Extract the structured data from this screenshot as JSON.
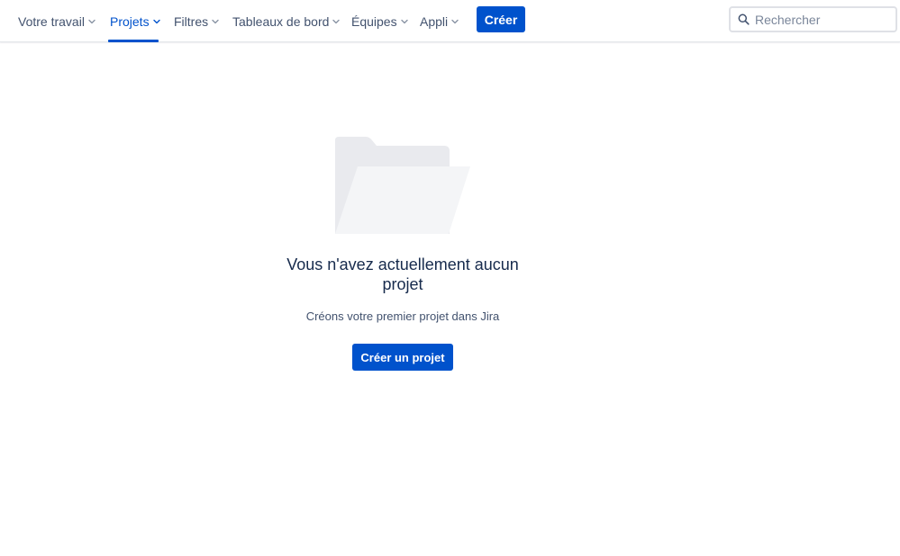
{
  "nav": {
    "items": [
      {
        "label": "Votre travail",
        "active": false
      },
      {
        "label": "Projets",
        "active": true
      },
      {
        "label": "Filtres",
        "active": false
      },
      {
        "label": "Tableaux de bord",
        "active": false
      },
      {
        "label": "Équipes",
        "active": false
      },
      {
        "label": "Appli",
        "active": false
      }
    ],
    "create_label": "Créer",
    "search_placeholder": "Rechercher",
    "search_icon": "search-icon",
    "dropdown_icon": "chevron-down-icon"
  },
  "empty_state": {
    "illustration": "folder-icon",
    "title": "Vous n'avez actuellement aucun projet",
    "description": "Créons votre premier projet dans Jira",
    "button_label": "Créer un projet"
  },
  "colors": {
    "accent": "#0052cc",
    "text_primary": "#172b4d",
    "text_secondary": "#42526e"
  }
}
